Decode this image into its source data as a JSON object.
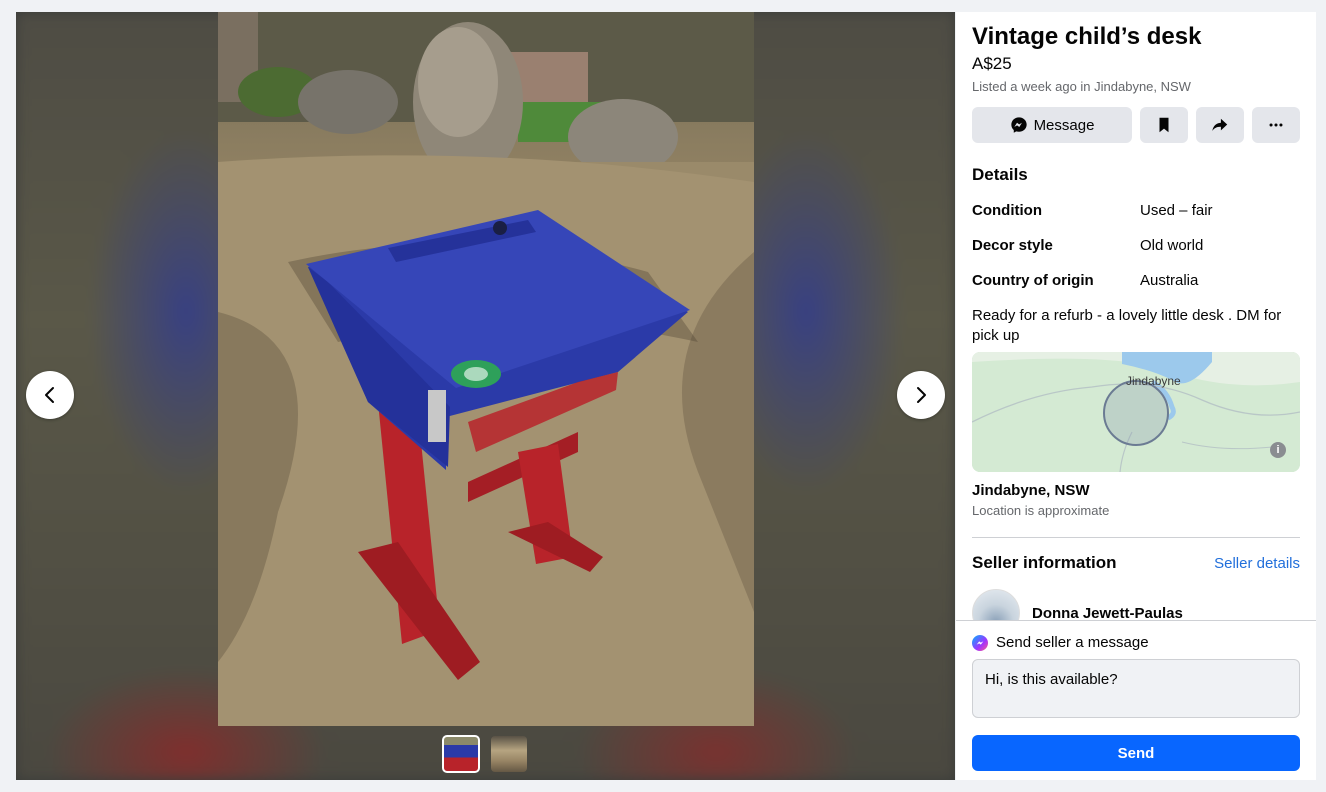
{
  "listing": {
    "title": "Vintage child’s desk",
    "price": "A$25",
    "listed": "Listed a week ago in Jindabyne, NSW"
  },
  "actions": {
    "message_label": "Message",
    "save_icon": "bookmark-icon",
    "share_icon": "share-icon",
    "more_icon": "more-icon"
  },
  "details": {
    "heading": "Details",
    "rows": [
      {
        "key": "Condition",
        "value": "Used – fair"
      },
      {
        "key": "Decor style",
        "value": "Old world"
      },
      {
        "key": "Country of origin",
        "value": "Australia"
      }
    ],
    "description": "Ready for a refurb - a lovely little desk . DM for pick up"
  },
  "location": {
    "map_label": "Jindabyne",
    "name": "Jindabyne, NSW",
    "note": "Location is approximate"
  },
  "seller": {
    "heading": "Seller information",
    "details_link": "Seller details",
    "name": "Donna Jewett-Paulas"
  },
  "message_box": {
    "heading": "Send seller a message",
    "input_value": "Hi, is this available?",
    "send_label": "Send"
  },
  "colors": {
    "accent": "#0866ff",
    "link": "#216fdb",
    "desk_blue": "#2b3aa8",
    "desk_red": "#b8232a"
  }
}
